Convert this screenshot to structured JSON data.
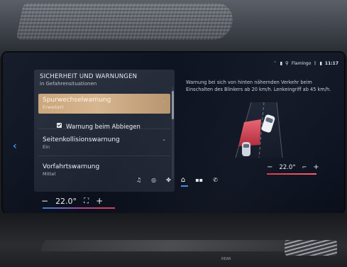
{
  "status_bar": {
    "icons": [
      "wifi-icon",
      "phone-icon",
      "signal-icon"
    ],
    "network": "Flamingo",
    "time": "11:17"
  },
  "menu": {
    "title": "SICHERHEIT UND WARNUNGEN",
    "subtitle": "in Gefahrensituationen",
    "items": [
      {
        "label": "Spurwechselwarnung",
        "value": "Erweitert",
        "selected": true
      },
      {
        "label": "Warnung beim Abbiegen",
        "checkbox": true,
        "checked": true
      },
      {
        "label": "Seitenkollisionswarnung",
        "value": "Ein"
      },
      {
        "label": "Vorfahrtswarnung",
        "value": "Mittel"
      }
    ]
  },
  "info": {
    "description": "Warnung bei sich von hinten nähernden Verkehr beim Einschalten des Blinkers ab 20 km/h. Lenkeingriff ab 45 km/h."
  },
  "climate": {
    "left": {
      "minus": "−",
      "temp": "22.0°",
      "plus": "+"
    },
    "right": {
      "minus": "−",
      "temp": "22.0°",
      "plus": "+"
    }
  },
  "dock": {
    "items": [
      "music-icon",
      "navigation-icon",
      "fan-icon",
      "home-icon",
      "apps-icon",
      "phone-icon"
    ]
  },
  "colors": {
    "accent_blue": "#3d8cf0",
    "selection_gold": "#c9a47a",
    "warning_red": "#e03c4c"
  },
  "bottom_label": "REAR"
}
